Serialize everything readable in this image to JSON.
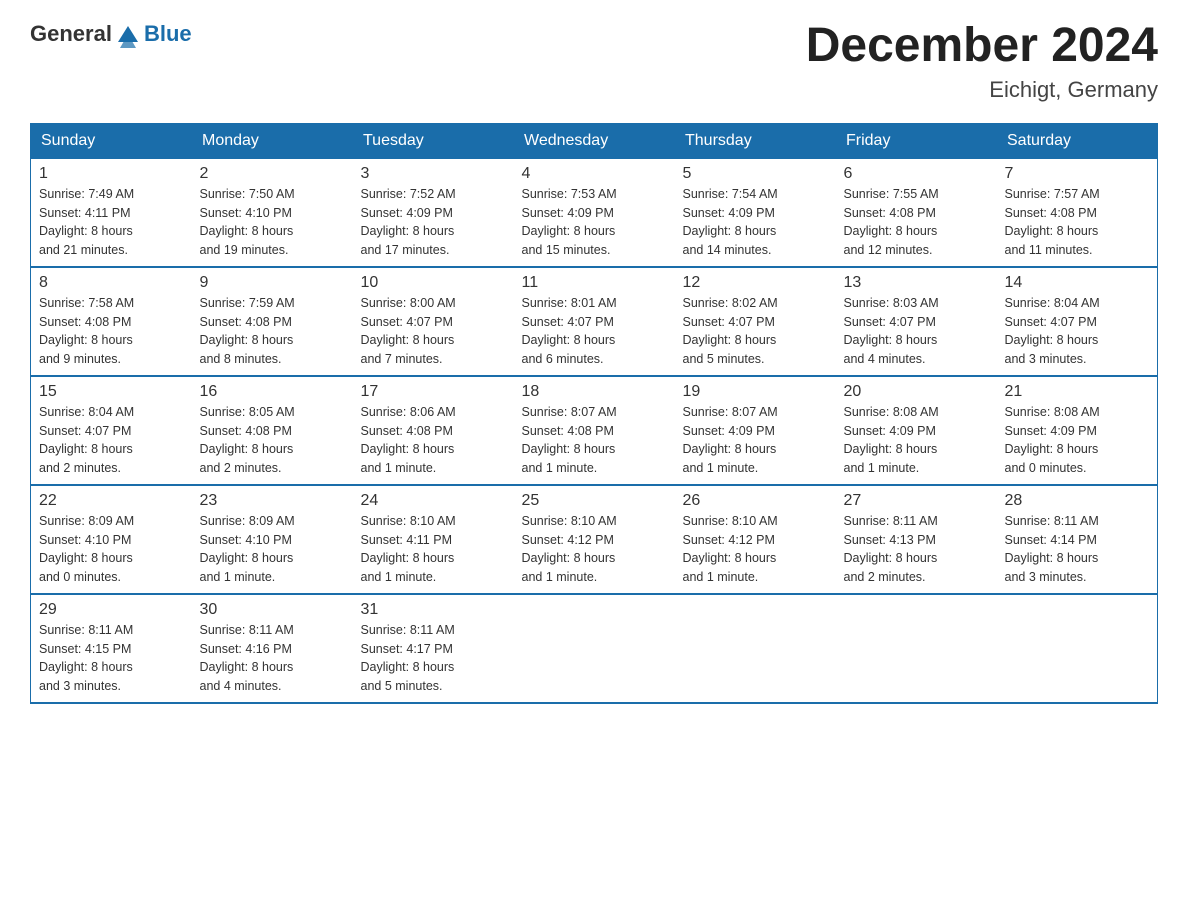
{
  "logo": {
    "general": "General",
    "blue": "Blue"
  },
  "header": {
    "month": "December 2024",
    "location": "Eichigt, Germany"
  },
  "weekdays": [
    "Sunday",
    "Monday",
    "Tuesday",
    "Wednesday",
    "Thursday",
    "Friday",
    "Saturday"
  ],
  "weeks": [
    [
      {
        "day": "1",
        "sunrise": "7:49 AM",
        "sunset": "4:11 PM",
        "daylight": "8 hours and 21 minutes."
      },
      {
        "day": "2",
        "sunrise": "7:50 AM",
        "sunset": "4:10 PM",
        "daylight": "8 hours and 19 minutes."
      },
      {
        "day": "3",
        "sunrise": "7:52 AM",
        "sunset": "4:09 PM",
        "daylight": "8 hours and 17 minutes."
      },
      {
        "day": "4",
        "sunrise": "7:53 AM",
        "sunset": "4:09 PM",
        "daylight": "8 hours and 15 minutes."
      },
      {
        "day": "5",
        "sunrise": "7:54 AM",
        "sunset": "4:09 PM",
        "daylight": "8 hours and 14 minutes."
      },
      {
        "day": "6",
        "sunrise": "7:55 AM",
        "sunset": "4:08 PM",
        "daylight": "8 hours and 12 minutes."
      },
      {
        "day": "7",
        "sunrise": "7:57 AM",
        "sunset": "4:08 PM",
        "daylight": "8 hours and 11 minutes."
      }
    ],
    [
      {
        "day": "8",
        "sunrise": "7:58 AM",
        "sunset": "4:08 PM",
        "daylight": "8 hours and 9 minutes."
      },
      {
        "day": "9",
        "sunrise": "7:59 AM",
        "sunset": "4:08 PM",
        "daylight": "8 hours and 8 minutes."
      },
      {
        "day": "10",
        "sunrise": "8:00 AM",
        "sunset": "4:07 PM",
        "daylight": "8 hours and 7 minutes."
      },
      {
        "day": "11",
        "sunrise": "8:01 AM",
        "sunset": "4:07 PM",
        "daylight": "8 hours and 6 minutes."
      },
      {
        "day": "12",
        "sunrise": "8:02 AM",
        "sunset": "4:07 PM",
        "daylight": "8 hours and 5 minutes."
      },
      {
        "day": "13",
        "sunrise": "8:03 AM",
        "sunset": "4:07 PM",
        "daylight": "8 hours and 4 minutes."
      },
      {
        "day": "14",
        "sunrise": "8:04 AM",
        "sunset": "4:07 PM",
        "daylight": "8 hours and 3 minutes."
      }
    ],
    [
      {
        "day": "15",
        "sunrise": "8:04 AM",
        "sunset": "4:07 PM",
        "daylight": "8 hours and 2 minutes."
      },
      {
        "day": "16",
        "sunrise": "8:05 AM",
        "sunset": "4:08 PM",
        "daylight": "8 hours and 2 minutes."
      },
      {
        "day": "17",
        "sunrise": "8:06 AM",
        "sunset": "4:08 PM",
        "daylight": "8 hours and 1 minute."
      },
      {
        "day": "18",
        "sunrise": "8:07 AM",
        "sunset": "4:08 PM",
        "daylight": "8 hours and 1 minute."
      },
      {
        "day": "19",
        "sunrise": "8:07 AM",
        "sunset": "4:09 PM",
        "daylight": "8 hours and 1 minute."
      },
      {
        "day": "20",
        "sunrise": "8:08 AM",
        "sunset": "4:09 PM",
        "daylight": "8 hours and 1 minute."
      },
      {
        "day": "21",
        "sunrise": "8:08 AM",
        "sunset": "4:09 PM",
        "daylight": "8 hours and 0 minutes."
      }
    ],
    [
      {
        "day": "22",
        "sunrise": "8:09 AM",
        "sunset": "4:10 PM",
        "daylight": "8 hours and 0 minutes."
      },
      {
        "day": "23",
        "sunrise": "8:09 AM",
        "sunset": "4:10 PM",
        "daylight": "8 hours and 1 minute."
      },
      {
        "day": "24",
        "sunrise": "8:10 AM",
        "sunset": "4:11 PM",
        "daylight": "8 hours and 1 minute."
      },
      {
        "day": "25",
        "sunrise": "8:10 AM",
        "sunset": "4:12 PM",
        "daylight": "8 hours and 1 minute."
      },
      {
        "day": "26",
        "sunrise": "8:10 AM",
        "sunset": "4:12 PM",
        "daylight": "8 hours and 1 minute."
      },
      {
        "day": "27",
        "sunrise": "8:11 AM",
        "sunset": "4:13 PM",
        "daylight": "8 hours and 2 minutes."
      },
      {
        "day": "28",
        "sunrise": "8:11 AM",
        "sunset": "4:14 PM",
        "daylight": "8 hours and 3 minutes."
      }
    ],
    [
      {
        "day": "29",
        "sunrise": "8:11 AM",
        "sunset": "4:15 PM",
        "daylight": "8 hours and 3 minutes."
      },
      {
        "day": "30",
        "sunrise": "8:11 AM",
        "sunset": "4:16 PM",
        "daylight": "8 hours and 4 minutes."
      },
      {
        "day": "31",
        "sunrise": "8:11 AM",
        "sunset": "4:17 PM",
        "daylight": "8 hours and 5 minutes."
      },
      null,
      null,
      null,
      null
    ]
  ]
}
